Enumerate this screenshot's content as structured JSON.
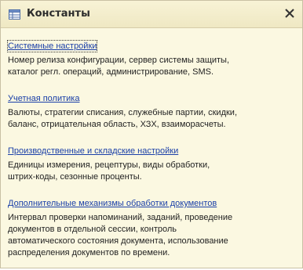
{
  "window": {
    "title": "Константы",
    "close_glyph": "✕",
    "icon": "grid-table-icon"
  },
  "sections": [
    {
      "link": "Системные настройки",
      "description": "Номер релиза конфигурации, сервер системы защиты,\nкаталог регл. операций, администрирование, SMS."
    },
    {
      "link": "Учетная политика",
      "description": "Валюты, стратегии списания, служебные партии, скидки,\nбаланс, отрицательная область, ХЗХ, взаиморасчеты."
    },
    {
      "link": "Производственные и складские настройки",
      "description": "Единицы измерения, рецептуры, виды обработки,\nштрих-коды, сезонные проценты."
    },
    {
      "link": "Дополнительные механизмы обработки документов",
      "description": "Интервал проверки напоминаний, заданий, проведение\nдокументов в отдельной сессии, контроль\nавтоматического состояния документа, использование\nраспределения документов по времени."
    }
  ],
  "colors": {
    "background": "#fbf8e1",
    "link": "#1a3fa8",
    "text": "#222222"
  }
}
